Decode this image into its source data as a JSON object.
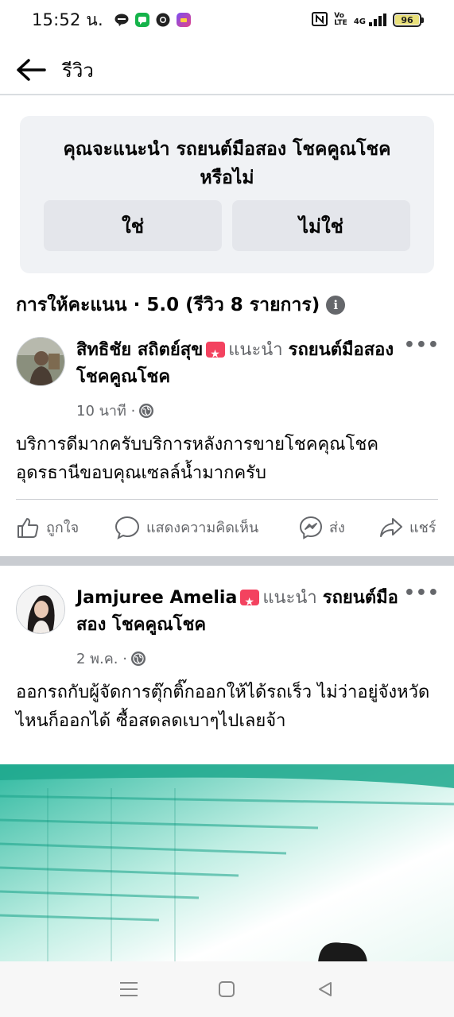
{
  "status_bar": {
    "time": "15:52 น.",
    "apps": [
      "line-icon",
      "chat-icon",
      "chrome-icon",
      "app-icon"
    ],
    "signal_text": "4G",
    "battery": "96"
  },
  "header": {
    "title": "รีวิว"
  },
  "recommend": {
    "question": "คุณจะแนะนำ รถยนต์มือสอง โชคคูณโชค หรือไม่",
    "yes_label": "ใช่",
    "no_label": "ไม่ใช่"
  },
  "rating": {
    "text": "การให้คะแนน · 5.0 (รีวิว 8 รายการ)"
  },
  "reviews": [
    {
      "author": "สิทธิชัย สถิตย์สุข",
      "recommends": "แนะนำ",
      "page": "รถยนต์มือสอง โชคคูณโชค",
      "time": "10 นาที ·",
      "text": "บริการดีมากครับบริการหลังการขายโชคคุณโชคอุดรธานีขอบคุณเซลล์น้ำมากครับ",
      "more": "•••"
    },
    {
      "author": "Jamjuree Amelia",
      "recommends": "แนะนำ",
      "page": "รถยนต์มือสอง โชคคูณโชค",
      "time": "2 พ.ค. ·",
      "text": "ออกรถกับผู้จัดการตุ๊กติ๊กออกให้ได้รถเร็ว ไม่ว่าอยู่จังหวัดไหนก็ออกได้ ซื้อสดลดเบาๆไปเลยจ้า",
      "more": "•••"
    }
  ],
  "actions": {
    "like": "ถูกใจ",
    "comment": "แสดงความคิดเห็น",
    "send": "ส่ง",
    "share": "แชร์"
  },
  "colors": {
    "card_bg": "#f0f2f5",
    "button_bg": "#e4e6eb",
    "muted": "#65676b",
    "badge": "#f3425f",
    "photo_teal": "#1fb59b"
  }
}
